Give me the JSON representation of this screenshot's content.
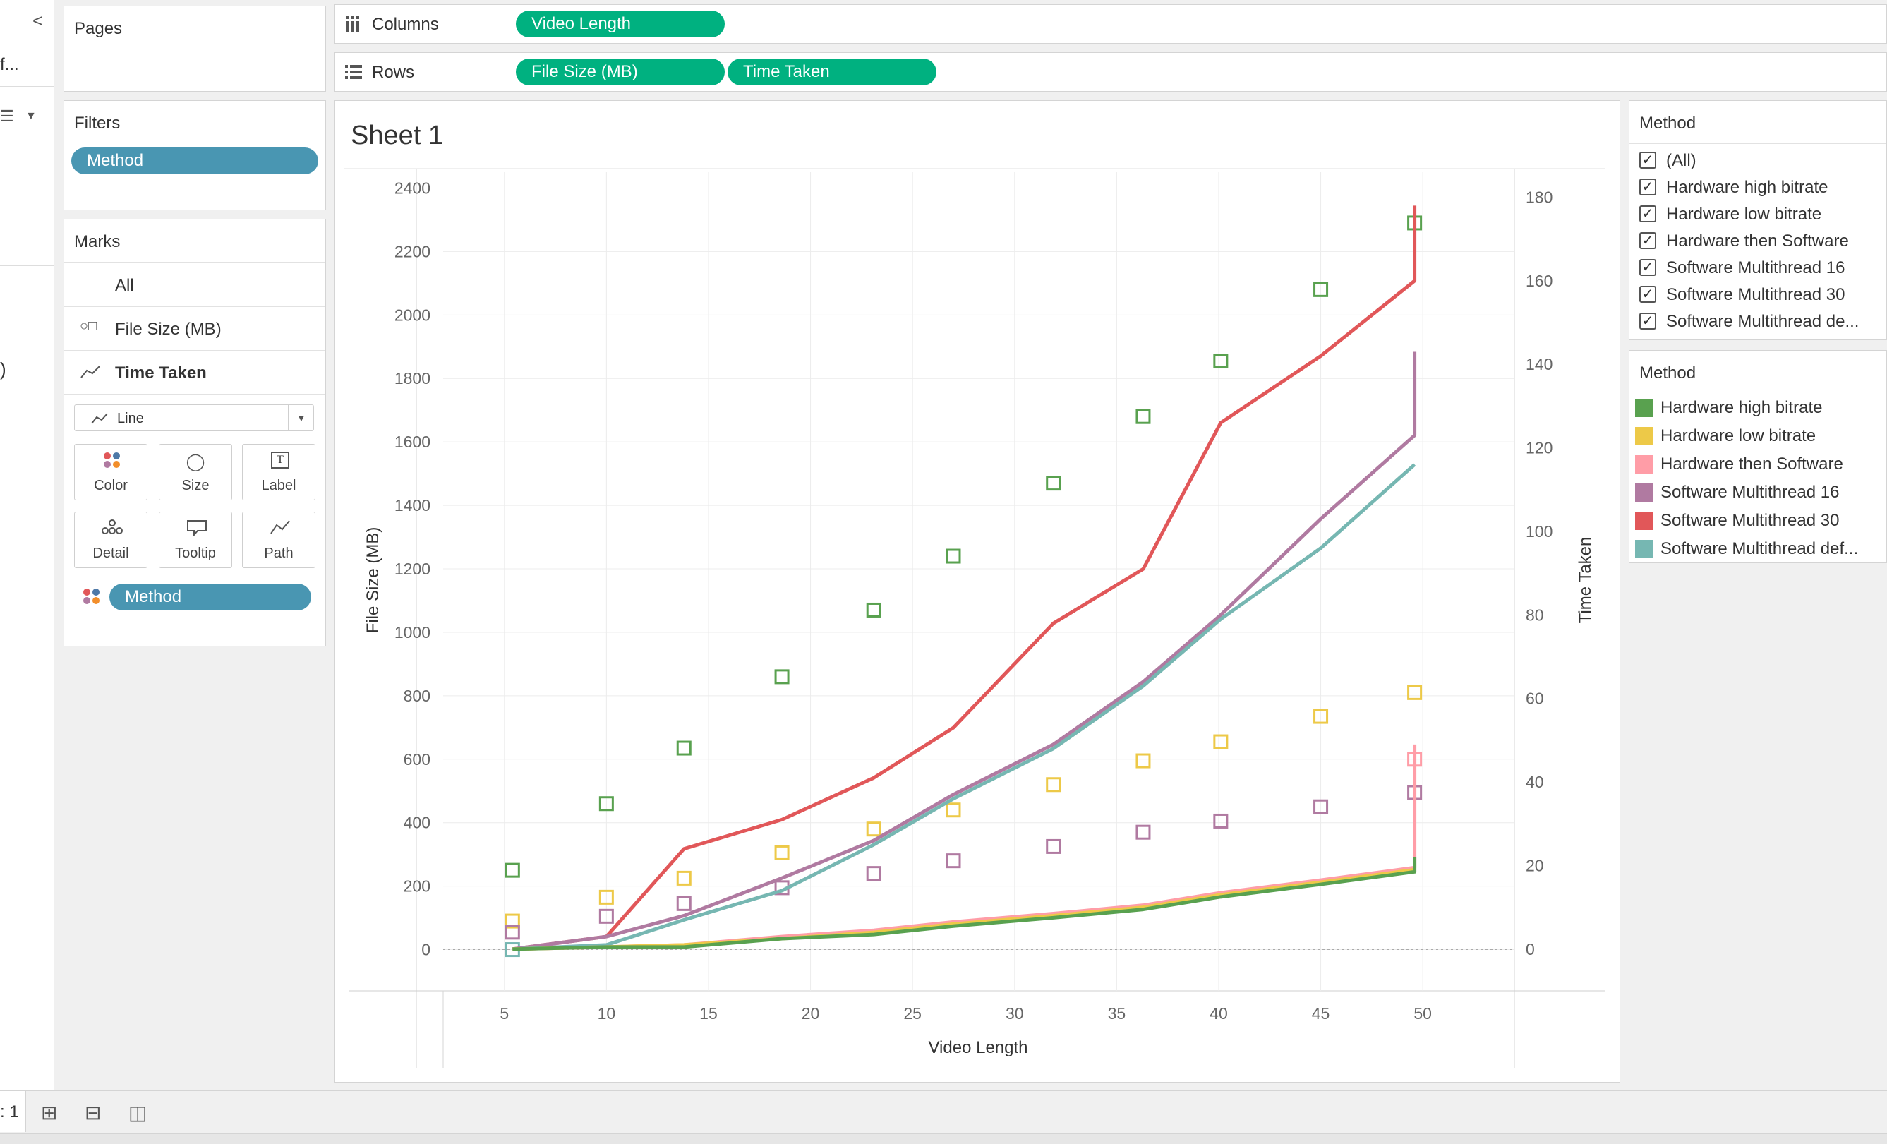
{
  "left_sidebar": {
    "collapse_glyph": "<",
    "truncated_item": "f...",
    "trailing_glyph": ")"
  },
  "pages_shelf": {
    "title": "Pages"
  },
  "filters_shelf": {
    "title": "Filters",
    "pill": "Method"
  },
  "marks_card": {
    "title": "Marks",
    "rows": [
      "All",
      "File Size (MB)",
      "Time Taken"
    ],
    "mark_type": "Line",
    "buttons": [
      "Color",
      "Size",
      "Label",
      "Detail",
      "Tooltip",
      "Path"
    ],
    "color_pill": "Method"
  },
  "columns_shelf": {
    "label": "Columns",
    "pills": [
      "Video Length"
    ]
  },
  "rows_shelf": {
    "label": "Rows",
    "pills": [
      "File Size (MB)",
      "Time Taken"
    ]
  },
  "sheet": {
    "title": "Sheet 1"
  },
  "filter_card": {
    "title": "Method",
    "items": [
      "(All)",
      "Hardware high bitrate",
      "Hardware low bitrate",
      "Hardware then Software",
      "Software Multithread 16",
      "Software Multithread 30",
      "Software Multithread de..."
    ]
  },
  "legend_card": {
    "title": "Method",
    "items": [
      {
        "label": "Hardware high bitrate",
        "color": "#59a14f"
      },
      {
        "label": "Hardware low bitrate",
        "color": "#edc948"
      },
      {
        "label": "Hardware then Software",
        "color": "#ff9da7"
      },
      {
        "label": "Software Multithread 16",
        "color": "#b07aa1"
      },
      {
        "label": "Software Multithread 30",
        "color": "#e15759"
      },
      {
        "label": "Software Multithread def...",
        "color": "#76b7b2"
      }
    ]
  },
  "bottom_bar": {
    "sheet_tab": ": 1"
  },
  "chart_data": {
    "type": "line",
    "xlabel": "Video Length",
    "ylabel": "File Size (MB)",
    "y2label": "Time Taken",
    "xlim": [
      2,
      52
    ],
    "ylim": [
      -130,
      2450
    ],
    "y2lim": [
      -10,
      186
    ],
    "x_ticks": [
      5,
      10,
      15,
      20,
      25,
      30,
      35,
      40,
      45,
      50
    ],
    "y_ticks": [
      0,
      200,
      400,
      600,
      800,
      1000,
      1200,
      1400,
      1600,
      1800,
      2000,
      2200,
      2400
    ],
    "y2_ticks": [
      0,
      20,
      40,
      60,
      80,
      100,
      120,
      140,
      160,
      180
    ],
    "grid": true,
    "square_series": [
      {
        "name": "Hardware high bitrate",
        "color": "#59a14f",
        "points": [
          [
            5.4,
            250
          ],
          [
            10,
            460
          ],
          [
            13.8,
            635
          ],
          [
            18.6,
            860
          ],
          [
            23.1,
            1070
          ],
          [
            27,
            1240
          ],
          [
            31.9,
            1470
          ],
          [
            36.3,
            1680
          ],
          [
            40.1,
            1855
          ],
          [
            45,
            2080
          ],
          [
            49.6,
            2290
          ]
        ]
      },
      {
        "name": "Hardware low bitrate",
        "color": "#edc948",
        "points": [
          [
            5.4,
            90
          ],
          [
            10,
            165
          ],
          [
            13.8,
            225
          ],
          [
            18.6,
            305
          ],
          [
            23.1,
            380
          ],
          [
            27,
            440
          ],
          [
            31.9,
            520
          ],
          [
            36.3,
            595
          ],
          [
            40.1,
            655
          ],
          [
            45,
            735
          ],
          [
            49.6,
            810
          ]
        ]
      },
      {
        "name": "Hardware then Software",
        "color": "#ff9da7",
        "points": [
          [
            49.6,
            600
          ]
        ]
      },
      {
        "name": "Software Multithread 16",
        "color": "#b07aa1",
        "points": [
          [
            5.4,
            55
          ],
          [
            10,
            105
          ],
          [
            13.8,
            145
          ],
          [
            18.6,
            195
          ],
          [
            23.1,
            240
          ],
          [
            27,
            280
          ],
          [
            31.9,
            325
          ],
          [
            36.3,
            370
          ],
          [
            40.1,
            405
          ],
          [
            45,
            450
          ],
          [
            49.6,
            495
          ]
        ]
      },
      {
        "name": "Software Multithread def...",
        "color": "#76b7b2",
        "points": [
          [
            5.4,
            0
          ]
        ]
      }
    ],
    "line_series": [
      {
        "name": "Software Multithread 30",
        "color": "#e15759",
        "points": [
          [
            5.4,
            0
          ],
          [
            10,
            3
          ],
          [
            13.8,
            24
          ],
          [
            18.6,
            31
          ],
          [
            23.1,
            41
          ],
          [
            27,
            53
          ],
          [
            31.9,
            78
          ],
          [
            36.3,
            91
          ],
          [
            40.1,
            126
          ],
          [
            45,
            142
          ],
          [
            49.6,
            160
          ],
          [
            49.6,
            178
          ]
        ]
      },
      {
        "name": "Software Multithread 16",
        "color": "#b07aa1",
        "points": [
          [
            5.4,
            0
          ],
          [
            10,
            3
          ],
          [
            13.8,
            8
          ],
          [
            18.6,
            17
          ],
          [
            23.1,
            26
          ],
          [
            27,
            37
          ],
          [
            31.9,
            49
          ],
          [
            36.3,
            64
          ],
          [
            40.1,
            80
          ],
          [
            45,
            103
          ],
          [
            49.6,
            123
          ],
          [
            49.6,
            143
          ]
        ]
      },
      {
        "name": "Software Multithread def...",
        "color": "#76b7b2",
        "points": [
          [
            5.4,
            0
          ],
          [
            10,
            1
          ],
          [
            13.8,
            7
          ],
          [
            18.6,
            14
          ],
          [
            23.1,
            25
          ],
          [
            27,
            36
          ],
          [
            31.9,
            48
          ],
          [
            36.3,
            63
          ],
          [
            40.1,
            79
          ],
          [
            45,
            96
          ],
          [
            49.6,
            116
          ]
        ]
      },
      {
        "name": "Hardware then Software",
        "color": "#ff9da7",
        "points": [
          [
            5.4,
            0
          ],
          [
            10,
            0.5
          ],
          [
            13.8,
            1
          ],
          [
            18.6,
            3
          ],
          [
            23.1,
            4.5
          ],
          [
            27,
            6.5
          ],
          [
            31.9,
            8.5
          ],
          [
            36.3,
            10.5
          ],
          [
            40.1,
            13.5
          ],
          [
            45,
            16.5
          ],
          [
            49.6,
            19.5
          ],
          [
            49.6,
            49
          ]
        ]
      },
      {
        "name": "Hardware low bitrate",
        "color": "#edc948",
        "points": [
          [
            5.4,
            0
          ],
          [
            10,
            0.5
          ],
          [
            13.8,
            1
          ],
          [
            18.6,
            2.5
          ],
          [
            23.1,
            4
          ],
          [
            27,
            6
          ],
          [
            31.9,
            8
          ],
          [
            36.3,
            10
          ],
          [
            40.1,
            13
          ],
          [
            45,
            16
          ],
          [
            49.6,
            19
          ]
        ]
      },
      {
        "name": "Hardware high bitrate",
        "color": "#59a14f",
        "points": [
          [
            5.4,
            0
          ],
          [
            10,
            0.5
          ],
          [
            13.8,
            0.5
          ],
          [
            18.6,
            2.5
          ],
          [
            23.1,
            3.5
          ],
          [
            27,
            5.5
          ],
          [
            31.9,
            7.5
          ],
          [
            36.3,
            9.5
          ],
          [
            40.1,
            12.5
          ],
          [
            45,
            15.5
          ],
          [
            49.6,
            18.5
          ],
          [
            49.6,
            22
          ]
        ]
      }
    ]
  }
}
